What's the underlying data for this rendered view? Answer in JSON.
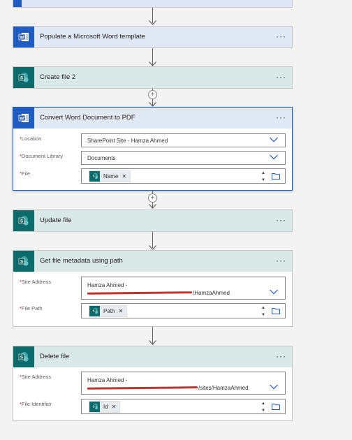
{
  "steps": {
    "populate": {
      "title": "Populate a Microsoft Word template"
    },
    "create": {
      "title": "Create file 2"
    },
    "convert": {
      "title": "Convert Word Document to PDF",
      "location_label": "Location",
      "location_value": "SharePoint Site - Hamza Ahmed",
      "library_label": "Document Library",
      "library_value": "Documents",
      "file_label": "File",
      "file_token": "Name"
    },
    "update": {
      "title": "Update file"
    },
    "metadata": {
      "title": "Get file metadata using path",
      "site_label": "Site Address",
      "site_line1": "Hamza Ahmed -",
      "site_line2_suffix": "/HamzaAhmed",
      "path_label": "File Path",
      "path_token": "Path"
    },
    "delete": {
      "title": "Delete file",
      "site_label": "Site Address",
      "site_line1": "Hamza Ahmed -",
      "site_line2_suffix": "/sites/HamzaAhmed",
      "id_label": "File Identifier",
      "id_token": "Id"
    }
  },
  "ui": {
    "more": "···",
    "required_mark": "*",
    "token_remove": "✕",
    "plus": "+",
    "spin_up": "▲",
    "spin_down": "▼"
  },
  "colors": {
    "word_blue": "#1e5cc1",
    "sharepoint_teal": "#0d6b6c",
    "selected_border": "#1b5bbd",
    "redaction_red": "#c0322b"
  }
}
